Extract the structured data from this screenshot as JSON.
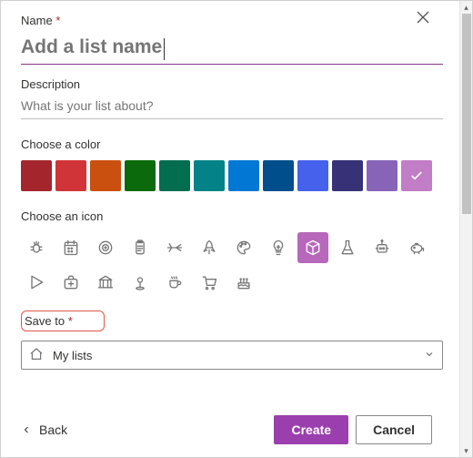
{
  "labels": {
    "name": "Name",
    "description": "Description",
    "choose_color": "Choose a color",
    "choose_icon": "Choose an icon",
    "save_to": "Save to",
    "required": "*"
  },
  "name_field": {
    "value": "",
    "placeholder": "Add a list name"
  },
  "description_field": {
    "value": "",
    "placeholder": "What is your list about?"
  },
  "colors": [
    {
      "name": "dark-red",
      "hex": "#a4262c",
      "selected": false
    },
    {
      "name": "red",
      "hex": "#d13438",
      "selected": false
    },
    {
      "name": "orange",
      "hex": "#ca5010",
      "selected": false
    },
    {
      "name": "green",
      "hex": "#0b6a0b",
      "selected": false
    },
    {
      "name": "dark-green",
      "hex": "#026d4f",
      "selected": false
    },
    {
      "name": "teal",
      "hex": "#038387",
      "selected": false
    },
    {
      "name": "blue",
      "hex": "#0078d4",
      "selected": false
    },
    {
      "name": "dark-blue",
      "hex": "#004e8c",
      "selected": false
    },
    {
      "name": "indigo",
      "hex": "#4661ec",
      "selected": false
    },
    {
      "name": "navy",
      "hex": "#373277",
      "selected": false
    },
    {
      "name": "purple",
      "hex": "#8764b8",
      "selected": false
    },
    {
      "name": "pink-purple",
      "hex": "#c17dc5",
      "selected": true
    }
  ],
  "icons": [
    {
      "name": "bug-icon"
    },
    {
      "name": "calendar-icon"
    },
    {
      "name": "target-icon"
    },
    {
      "name": "clipboard-icon"
    },
    {
      "name": "airplane-icon"
    },
    {
      "name": "rocket-icon"
    },
    {
      "name": "palette-icon"
    },
    {
      "name": "lightbulb-icon"
    },
    {
      "name": "cube-icon"
    },
    {
      "name": "flask-icon"
    },
    {
      "name": "robot-icon"
    },
    {
      "name": "piggybank-icon"
    },
    {
      "name": "play-icon"
    },
    {
      "name": "firstaid-icon"
    },
    {
      "name": "bank-icon"
    },
    {
      "name": "location-icon"
    },
    {
      "name": "coffee-icon"
    },
    {
      "name": "cart-icon"
    },
    {
      "name": "cake-icon"
    }
  ],
  "selected_icon": "cube-icon",
  "save_to": {
    "selected": "My lists"
  },
  "footer": {
    "back": "Back",
    "create": "Create",
    "cancel": "Cancel"
  }
}
